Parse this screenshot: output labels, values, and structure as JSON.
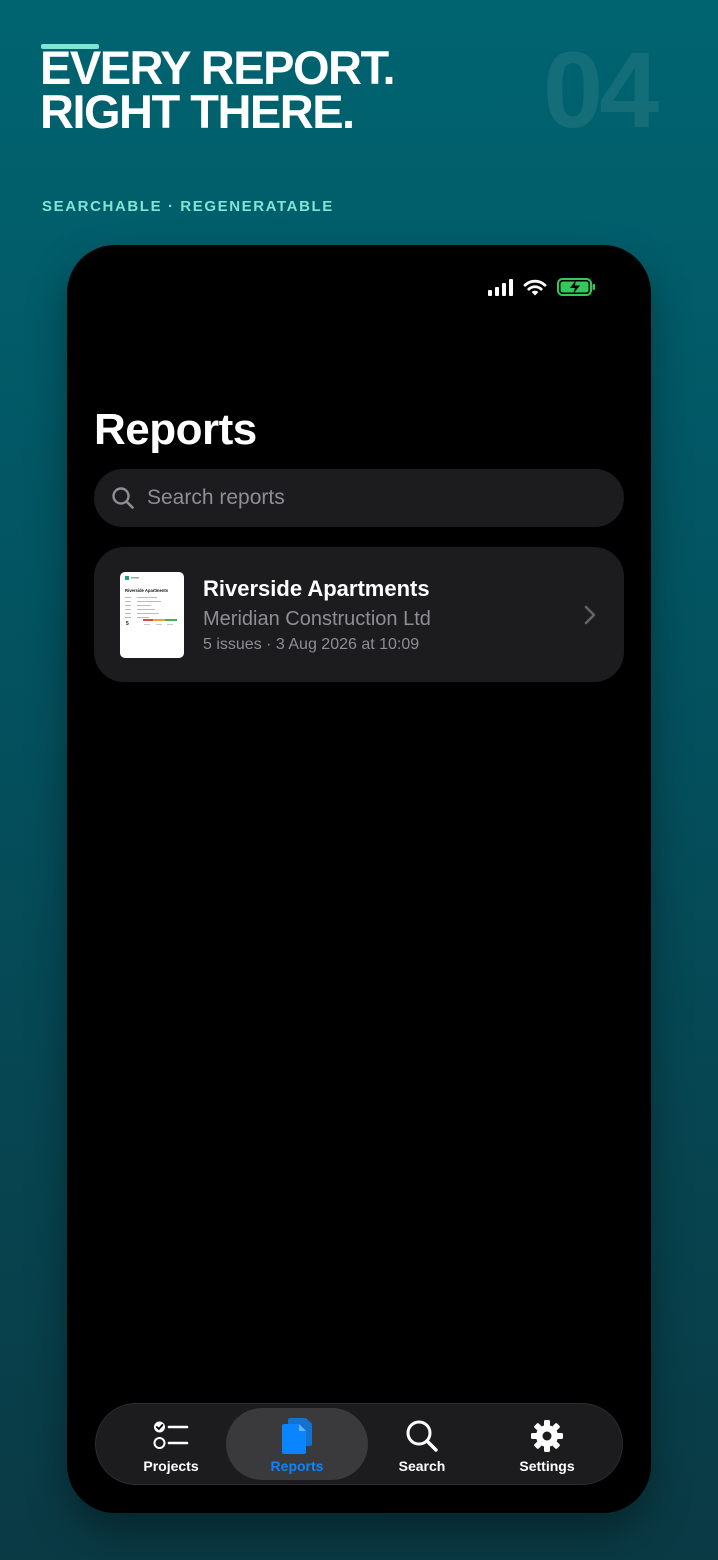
{
  "promo": {
    "headline_line1": "EVERY REPORT.",
    "headline_line2": "RIGHT THERE.",
    "number": "04",
    "tagline": "SEARCHABLE · REGENERATABLE",
    "accent_color": "#7fe6d6"
  },
  "screen": {
    "title": "Reports",
    "search": {
      "placeholder": "Search reports",
      "value": ""
    },
    "reports": [
      {
        "title": "Riverside Apartments",
        "client": "Meridian Construction Ltd",
        "meta": "5 issues · 3 Aug 2026 at 10:09",
        "thumbnail_title": "Riverside Apartments",
        "thumbnail_count": "5"
      }
    ],
    "tabs": [
      {
        "label": "Projects",
        "icon": "checklist-icon",
        "active": false
      },
      {
        "label": "Reports",
        "icon": "documents-icon",
        "active": true
      },
      {
        "label": "Search",
        "icon": "search-icon",
        "active": false
      },
      {
        "label": "Settings",
        "icon": "gear-icon",
        "active": false
      }
    ]
  },
  "colors": {
    "active_tab": "#0a84ff",
    "battery": "#34c759",
    "card_background": "#1c1c1e"
  }
}
